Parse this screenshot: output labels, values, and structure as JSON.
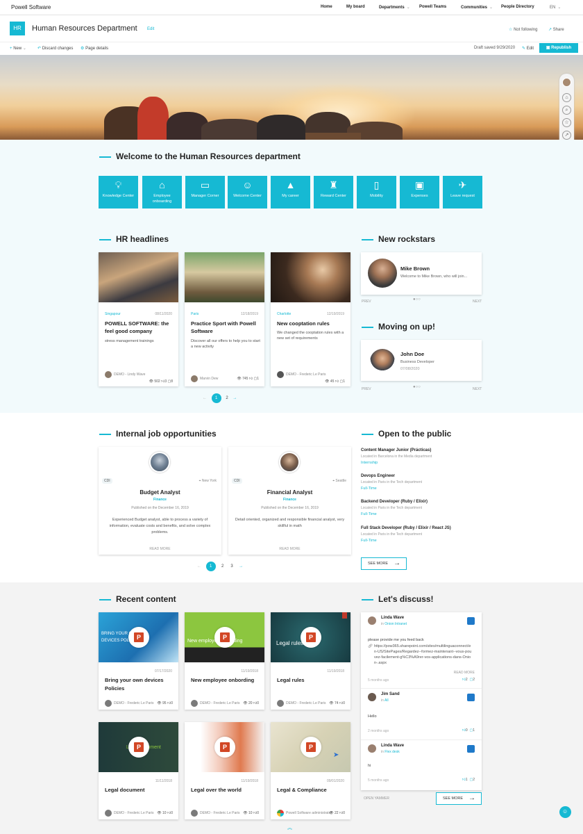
{
  "topnav": {
    "brand": "Powell Software",
    "items": [
      "Home",
      "My board",
      "Departments",
      "Powell Teams",
      "Communities",
      "People Directory"
    ],
    "lang": "EN"
  },
  "header": {
    "logo": "HR",
    "title": "Human Resources Department",
    "edit": "Edit",
    "follow": "Not following",
    "share": "Share"
  },
  "commandbar": {
    "new": "New",
    "discard": "Discard changes",
    "details": "Page details",
    "draft": "Draft saved 9/29/2020",
    "edit": "Edit",
    "republish": "Republish"
  },
  "welcome": {
    "title": "Welcome to the Human Resources department",
    "tiles": [
      {
        "label": "Knowledge Center",
        "icon": "lightbulb-icon"
      },
      {
        "label": "Employee onboarding",
        "icon": "building-icon"
      },
      {
        "label": "Manager Corner",
        "icon": "chat-icon"
      },
      {
        "label": "Welcome Center",
        "icon": "people-icon"
      },
      {
        "label": "My career",
        "icon": "graduation-icon"
      },
      {
        "label": "Reward Center",
        "icon": "trophy-icon"
      },
      {
        "label": "Mobility",
        "icon": "mobile-icon"
      },
      {
        "label": "Expenses",
        "icon": "money-icon"
      },
      {
        "label": "Leave request",
        "icon": "plane-icon"
      }
    ]
  },
  "headlines": {
    "title": "HR headlines",
    "cards": [
      {
        "location": "Singapour",
        "date": "08/11/2020",
        "title": "POWELL SOFTWARE: the feel good company",
        "desc": "stress management trainings",
        "author": "DEMO - Lindy Wave",
        "views": "502",
        "likes": "3",
        "comments": "8"
      },
      {
        "location": "Paris",
        "date": "12/18/2019",
        "title": "Practice Sport with Powell Software",
        "desc": "Discover all our offers to help you to start a new activity",
        "author": "Marvin Dew",
        "views": "745",
        "likes": "",
        "comments": "1"
      },
      {
        "location": "Charlotte",
        "date": "12/19/2019",
        "title": "New cooptation rules",
        "desc": "We changed the cooptation rules with a new set of requirements",
        "author": "DEMO - Frederic Le Paris",
        "views": "45",
        "likes": "",
        "comments": "1"
      }
    ],
    "pages": [
      "1",
      "2"
    ]
  },
  "rockstars": {
    "title": "New rockstars",
    "name": "Mike Brown",
    "text": "Welcome to Mike Brown, who will join...",
    "prev": "PREV",
    "next": "NEXT"
  },
  "movingup": {
    "title": "Moving on up!",
    "name": "John Doe",
    "role": "Business Developer",
    "date": "07/08/2020",
    "prev": "PREV",
    "next": "NEXT"
  },
  "jobs": {
    "title": "Internal job opportunities",
    "cards": [
      {
        "type": "CDI",
        "location": "New York",
        "title": "Budget Analyst",
        "dept": "Finance",
        "published": "Published on the December 16, 2019",
        "desc": "Experienced Budget analyst, able to process a variety of information, evaluate costs and benefits, and solve complex problems.",
        "readmore": "READ MORE"
      },
      {
        "type": "CDI",
        "location": "Seattle",
        "title": "Financial Analyst",
        "dept": "Finance",
        "published": "Published on the December 16, 2019",
        "desc": "Detail oriented, organized and responsible financial analyst, very skillful in math",
        "readmore": "READ MORE"
      }
    ],
    "pages": [
      "1",
      "2",
      "3"
    ]
  },
  "public": {
    "title": "Open to the public",
    "items": [
      {
        "title": "Content Manager Junior (Prácticas)",
        "location": "Located in Barcelona in the Media department",
        "type": "Internship"
      },
      {
        "title": "Devops Engineer",
        "location": "Located in Paris in the Tech department",
        "type": "Full-Time"
      },
      {
        "title": "Backend Developer (Ruby / Elixir)",
        "location": "Located in Paris in the Tech department",
        "type": "Full-Time"
      },
      {
        "title": "Full Stack Developer (Ruby / Elixir / React JS)",
        "location": "Located in Paris in the Tech department",
        "type": "Full-Time"
      }
    ],
    "seemore": "SEE MORE"
  },
  "recent": {
    "title": "Recent content",
    "cards": [
      {
        "date": "07/17/2020",
        "title": "Bring your own devices Policies",
        "author": "DEMO - Frederic Le Paris",
        "views": "95",
        "likes": "0",
        "img_text": "BRING YOUR OWN DEVICES POLICIES"
      },
      {
        "date": "11/19/2018",
        "title": "New employee onbording",
        "author": "DEMO - Frederic Le Paris",
        "views": "20",
        "likes": "0",
        "img_text": "New employee onbording"
      },
      {
        "date": "11/19/2018",
        "title": "Legal rules",
        "author": "DEMO - Frederic Le Paris",
        "views": "74",
        "likes": "0",
        "img_text": "Legal rules"
      },
      {
        "date": "11/11/2018",
        "title": "Legal document",
        "author": "DEMO - Frederic Le Paris",
        "views": "10",
        "likes": "0",
        "img_text": "Legal document"
      },
      {
        "date": "11/19/2018",
        "title": "Legal over the world",
        "author": "DEMO - Frederic Le Paris",
        "views": "10",
        "likes": "0",
        "img_text": ""
      },
      {
        "date": "09/01/2020",
        "title": "Legal & Compliance",
        "author": "Powell Software administrator",
        "views": "22",
        "likes": "0",
        "img_text": ""
      }
    ]
  },
  "discuss": {
    "title": "Let's discuss!",
    "posts": [
      {
        "name": "Linda Wave",
        "in": "in",
        "group": "Onion Intranet",
        "text": "please provide me you feed back",
        "link": "https://pow365.sharepoint.com/sites/multilinguaconnect/en-US/SitePages/Regardez--formez-maintenant--vous-pouvez-facilement-g%C3%A9rer-vos-applications-dans-Onion-.aspx",
        "readmore": "READ MORE",
        "ago": "5 months ago",
        "likes": "2",
        "comments": "2"
      },
      {
        "name": "Jim Sand",
        "in": "in",
        "group": "All",
        "text": "Hello",
        "ago": "2 months ago",
        "likes": "0",
        "comments": "1"
      },
      {
        "name": "Linda Wave",
        "in": "in",
        "group": "Flex desk",
        "text": "hi",
        "ago": "5 months ago",
        "likes": "1",
        "comments": "2"
      }
    ],
    "open": "OPEN YAMMER",
    "seemore": "SEE MORE"
  },
  "colors": {
    "accent": "#16b9d3"
  }
}
